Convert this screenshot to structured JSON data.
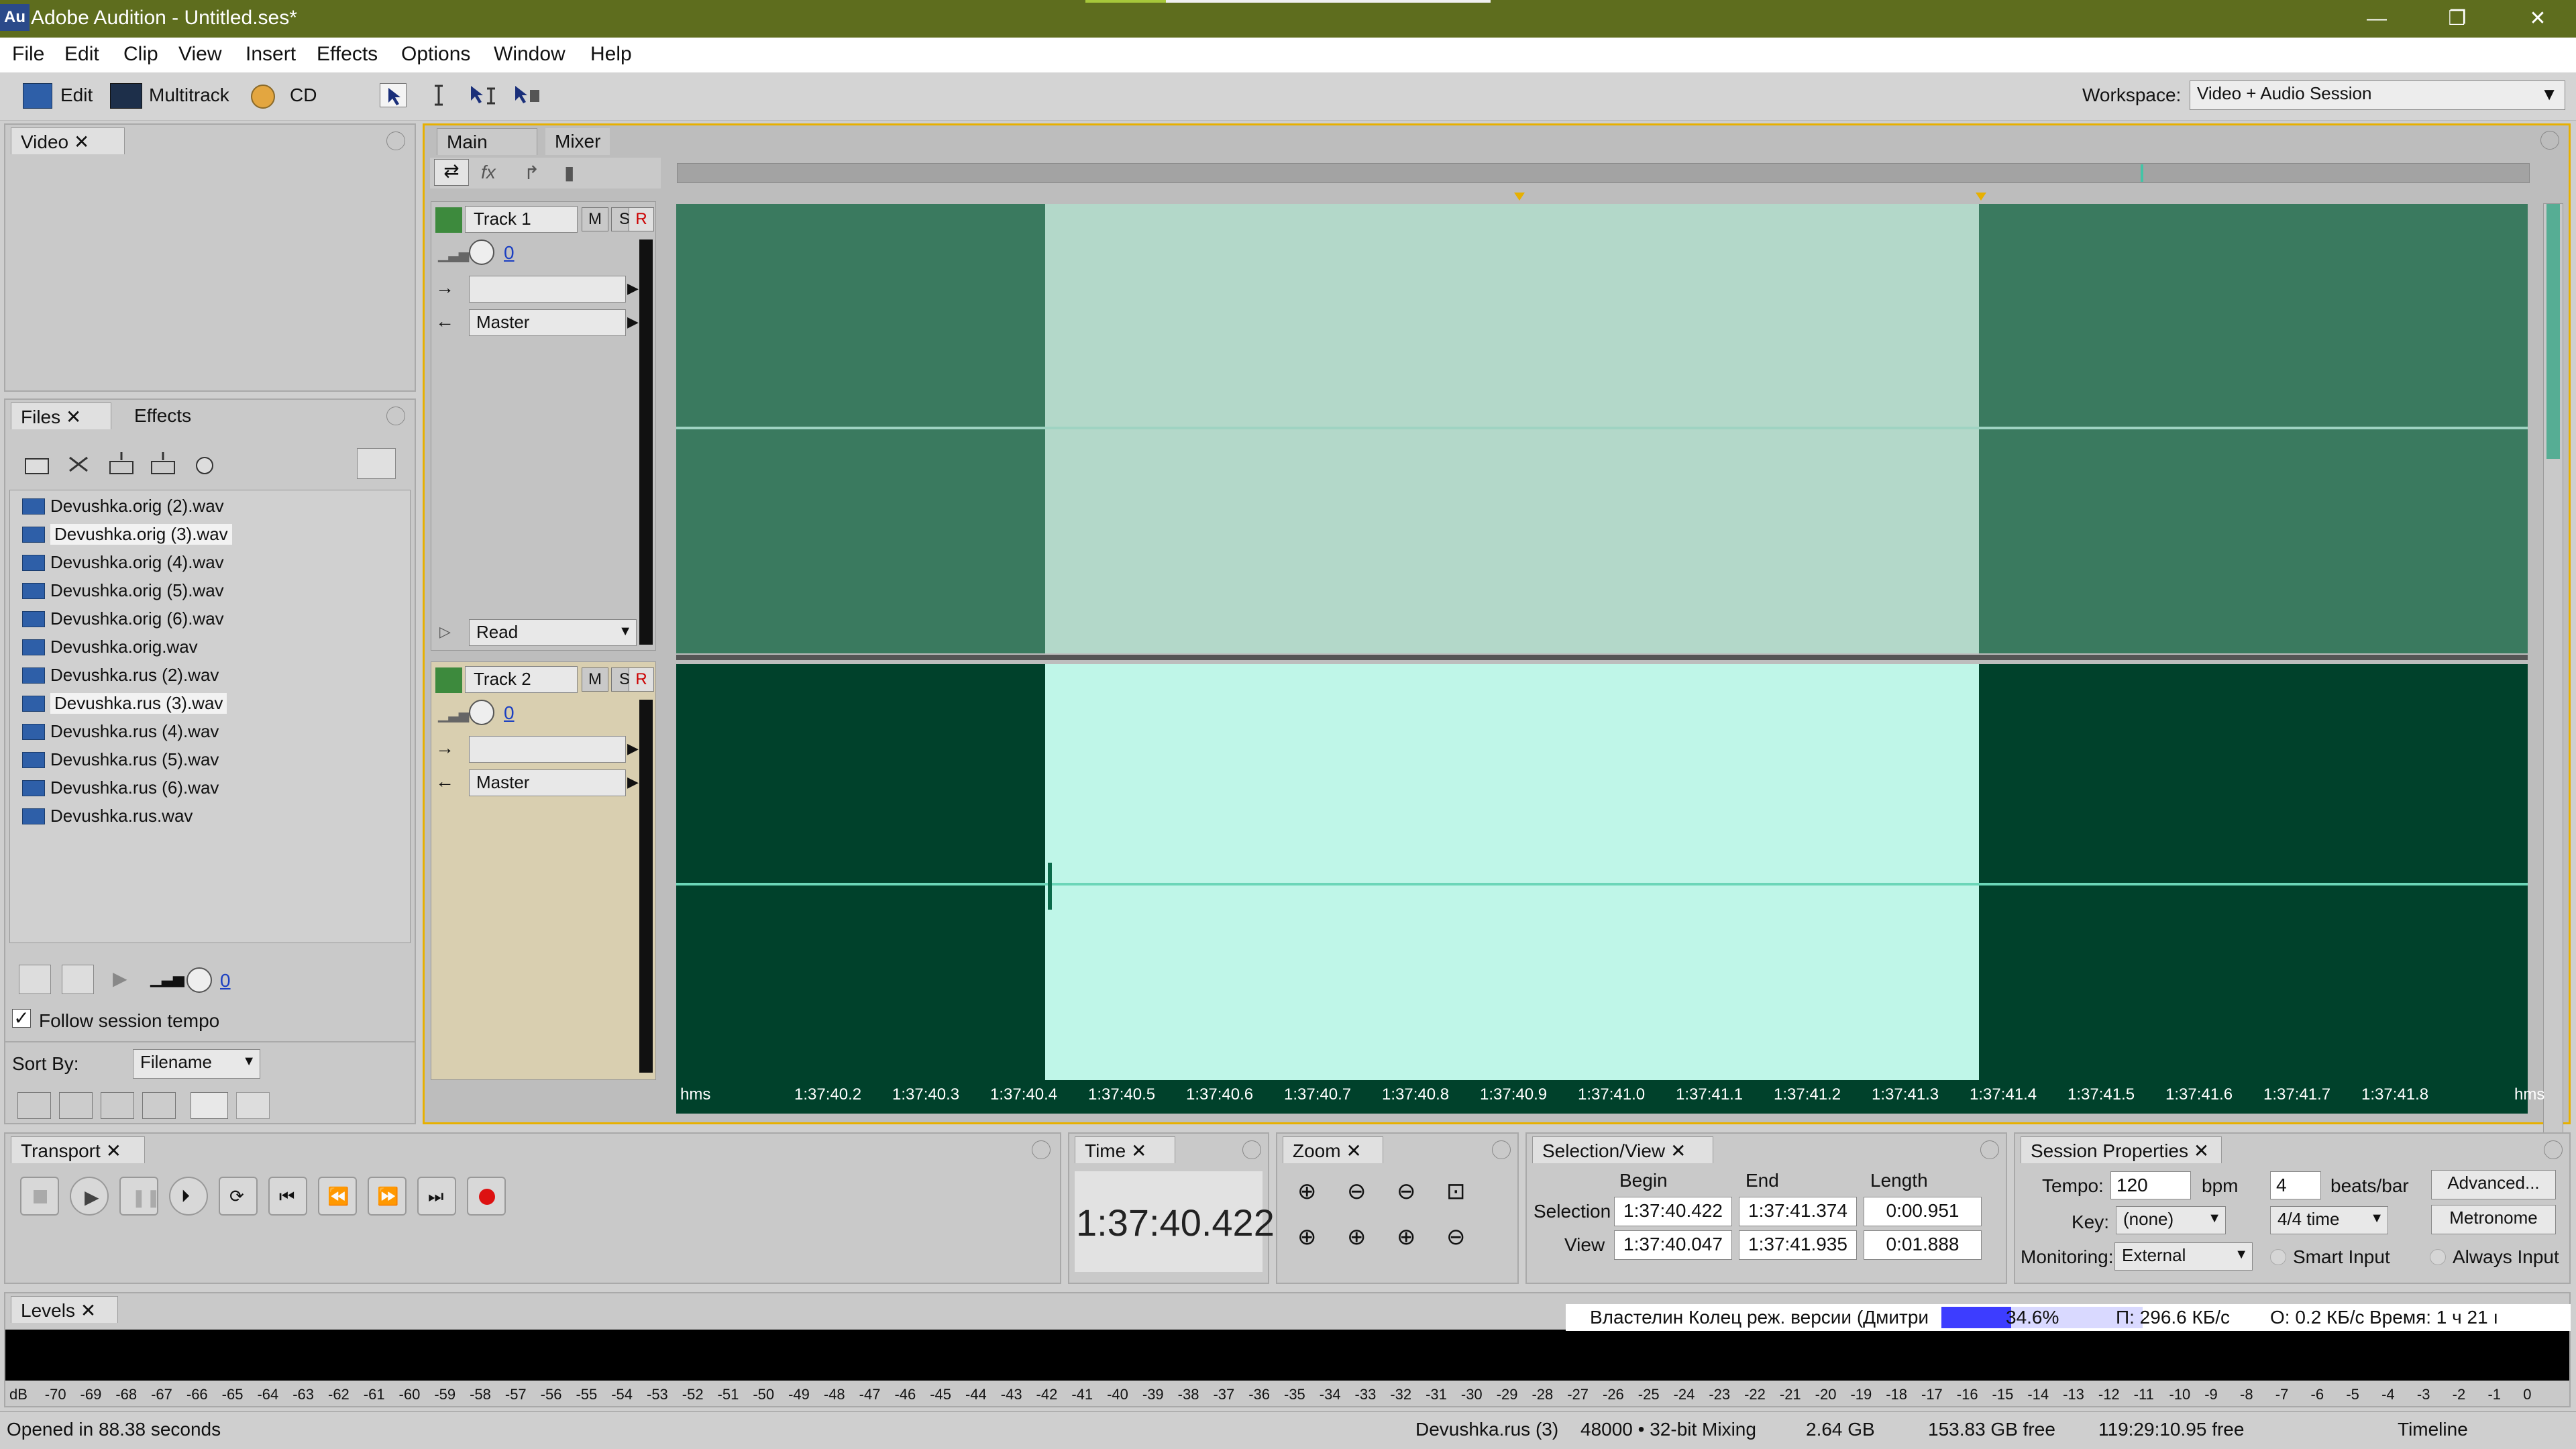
{
  "titlebar": {
    "app_icon": "Au",
    "title": "Adobe Audition - Untitled.ses*",
    "min": "—",
    "restore": "❐",
    "close": "✕"
  },
  "menu": [
    "File",
    "Edit",
    "Clip",
    "View",
    "Insert",
    "Effects",
    "Options",
    "Window",
    "Help"
  ],
  "toolbar": {
    "edit": "Edit",
    "multitrack": "Multitrack",
    "cd": "CD",
    "workspace_label": "Workspace:",
    "workspace_value": "Video + Audio Session"
  },
  "video_panel": {
    "tab": "Video"
  },
  "files_panel": {
    "tab_files": "Files",
    "tab_effects": "Effects",
    "files": [
      "Devushka.orig (2).wav",
      "Devushka.orig (3).wav",
      "Devushka.orig (4).wav",
      "Devushka.orig (5).wav",
      "Devushka.orig (6).wav",
      "Devushka.orig.wav",
      "Devushka.rus (2).wav",
      "Devushka.rus (3).wav",
      "Devushka.rus (4).wav",
      "Devushka.rus (5).wav",
      "Devushka.rus (6).wav",
      "Devushka.rus.wav"
    ],
    "volume": "0",
    "follow_tempo": "Follow session tempo",
    "sort_label": "Sort By:",
    "sort_value": "Filename"
  },
  "main_tabs": {
    "main": "Main",
    "mixer": "Mixer"
  },
  "tracks": [
    {
      "name": "Track 1",
      "m": "M",
      "s": "S",
      "r": "R",
      "volume": "0",
      "output": "Master",
      "automation": "Read"
    },
    {
      "name": "Track 2",
      "m": "M",
      "s": "S",
      "r": "R",
      "volume": "0",
      "output": "Master"
    }
  ],
  "timeline": {
    "unit_left": "hms",
    "unit_right": "hms",
    "ticks": [
      "1:37:40.2",
      "1:37:40.3",
      "1:37:40.4",
      "1:37:40.5",
      "1:37:40.6",
      "1:37:40.7",
      "1:37:40.8",
      "1:37:40.9",
      "1:37:41.0",
      "1:37:41.1",
      "1:37:41.2",
      "1:37:41.3",
      "1:37:41.4",
      "1:37:41.5",
      "1:37:41.6",
      "1:37:41.7",
      "1:37:41.8"
    ]
  },
  "transport": {
    "tab": "Transport"
  },
  "time": {
    "tab": "Time",
    "value": "1:37:40.422"
  },
  "zoom": {
    "tab": "Zoom"
  },
  "selview": {
    "tab": "Selection/View",
    "begin": "Begin",
    "end": "End",
    "length": "Length",
    "selection_label": "Selection",
    "view_label": "View",
    "sel_begin": "1:37:40.422",
    "sel_end": "1:37:41.374",
    "sel_len": "0:00.951",
    "view_begin": "1:37:40.047",
    "view_end": "1:37:41.935",
    "view_len": "0:01.888"
  },
  "session": {
    "tab": "Session Properties",
    "tempo_label": "Tempo:",
    "tempo": "120",
    "bpm": "bpm",
    "beats": "4",
    "beats_label": "beats/bar",
    "advanced": "Advanced...",
    "key_label": "Key:",
    "key": "(none)",
    "time_sig": "4/4 time",
    "metronome": "Metronome",
    "monitoring_label": "Monitoring:",
    "monitoring": "External",
    "smart_input": "Smart Input",
    "always_input": "Always Input"
  },
  "levels": {
    "tab": "Levels",
    "scale": [
      "dB",
      "-70",
      "-69",
      "-68",
      "-67",
      "-66",
      "-65",
      "-64",
      "-63",
      "-62",
      "-61",
      "-60",
      "-59",
      "-58",
      "-57",
      "-56",
      "-55",
      "-54",
      "-53",
      "-52",
      "-51",
      "-50",
      "-49",
      "-48",
      "-47",
      "-46",
      "-45",
      "-44",
      "-43",
      "-42",
      "-41",
      "-40",
      "-39",
      "-38",
      "-37",
      "-36",
      "-35",
      "-34",
      "-33",
      "-32",
      "-31",
      "-30",
      "-29",
      "-28",
      "-27",
      "-26",
      "-25",
      "-24",
      "-23",
      "-22",
      "-21",
      "-20",
      "-19",
      "-18",
      "-17",
      "-16",
      "-15",
      "-14",
      "-13",
      "-12",
      "-11",
      "-10",
      "-9",
      "-8",
      "-7",
      "-6",
      "-5",
      "-4",
      "-3",
      "-2",
      "-1",
      "0"
    ]
  },
  "download": {
    "name": "Властелин Колец реж. версии (Дмитри",
    "percent": "34.6%",
    "progress": 34.6,
    "in": "П: 296.6 КБ/с",
    "out": "О: 0.2 КБ/с",
    "time": "Время: 1 ч 21 ı"
  },
  "status": {
    "left": "Opened in 88.38 seconds",
    "file": "Devushka.rus (3)",
    "format": "48000 • 32-bit Mixing",
    "size": "2.64 GB",
    "free": "153.83 GB free",
    "duration": "119:29:10.95 free",
    "view": "Timeline"
  },
  "colors": {
    "title_bg": "#5e6d1e",
    "track1_wave": "#3a7a5f",
    "track1_sel": "#b3d8c9",
    "track2_wave": "#00412b",
    "track2_sel": "#bff6e8",
    "accent": "#e7b000"
  }
}
